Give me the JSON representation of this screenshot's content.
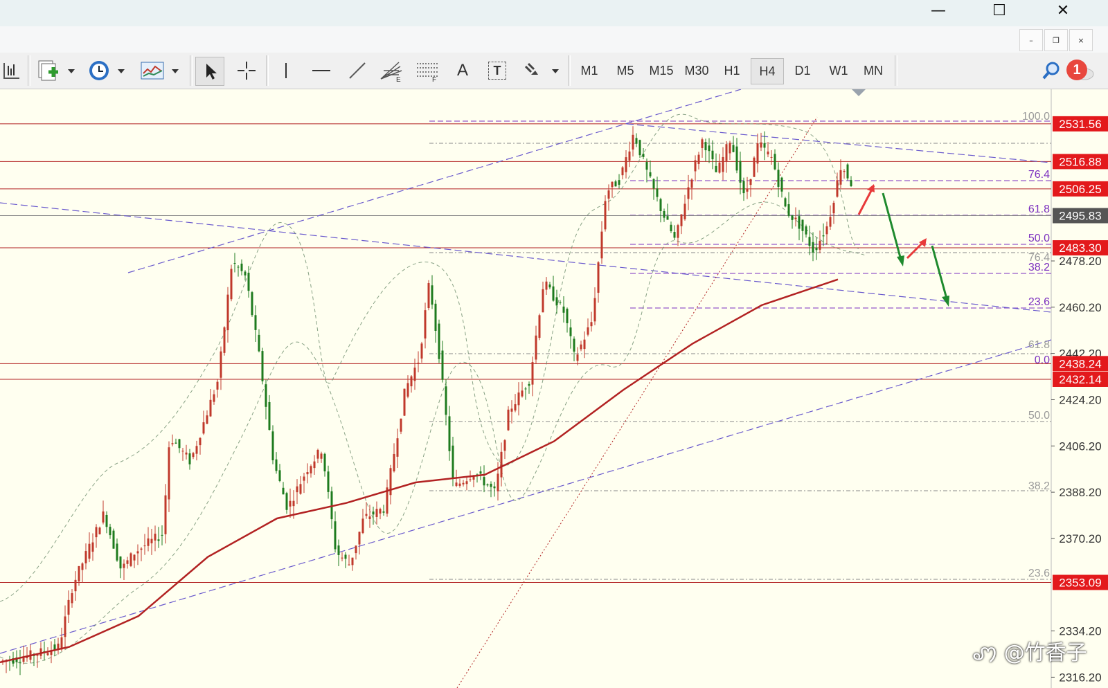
{
  "window": {
    "controls": {
      "minimize": "—",
      "maximize": "☐",
      "close": "✕"
    },
    "mdi_controls": {
      "minimize": "–",
      "restore": "❐",
      "close": "×"
    }
  },
  "toolbar": {
    "tools": [
      {
        "name": "crosshair-bars-icon"
      },
      {
        "name": "new-chart-icon"
      },
      {
        "name": "history-clock-icon"
      },
      {
        "name": "indicators-icon"
      },
      {
        "name": "cursor-icon"
      },
      {
        "name": "crosshair-icon"
      },
      {
        "name": "vertical-line-icon"
      },
      {
        "name": "horizontal-line-icon"
      },
      {
        "name": "trend-line-icon"
      },
      {
        "name": "fibonacci-fan-icon"
      },
      {
        "name": "fibonacci-retracement-icon"
      }
    ],
    "text_tool": "A",
    "text_label_tool": "T",
    "timeframes": [
      "M1",
      "M5",
      "M15",
      "M30",
      "H1",
      "H4",
      "D1",
      "W1",
      "MN"
    ],
    "active_timeframe": "H4",
    "notification_count": "1"
  },
  "chart_data": {
    "type": "line",
    "chart_kind": "candlestick",
    "timeframe": "H4",
    "price_axis": {
      "labels": [
        "2531.56",
        "2516.88",
        "2506.25",
        "2495.83",
        "2483.30",
        "2478.20",
        "2460.20",
        "2442.20",
        "2438.24",
        "2432.14",
        "2424.20",
        "2406.20",
        "2388.20",
        "2370.20",
        "2353.09",
        "2334.20",
        "2316.20"
      ],
      "ylim": [
        2312,
        2545
      ]
    },
    "horizontal_levels": [
      {
        "price": "2531.56",
        "highlight": true
      },
      {
        "price": "2516.88",
        "highlight": true
      },
      {
        "price": "2506.25",
        "highlight": true
      },
      {
        "price": "2495.83",
        "highlight": false
      },
      {
        "price": "2483.30",
        "highlight": true
      },
      {
        "price": "2438.24",
        "highlight": true
      },
      {
        "price": "2432.14",
        "highlight": true
      },
      {
        "price": "2353.09",
        "highlight": true
      }
    ],
    "fibo_upper": [
      "100.0",
      "76.4",
      "61.8",
      "50.0",
      "38.2",
      "23.6",
      "0.0"
    ],
    "fibo_lower": [
      "76.4",
      "61.8",
      "50.0",
      "38.2",
      "23.6"
    ],
    "moving_average": {
      "x": [
        0,
        100,
        200,
        300,
        400,
        500,
        600,
        700,
        800,
        900,
        1000,
        1100,
        1210
      ],
      "y": [
        2322,
        2328,
        2340,
        2363,
        2378,
        2384,
        2392,
        2395,
        2408,
        2428,
        2446,
        2461,
        2471
      ]
    },
    "colors": {
      "background": "#fffff0",
      "up_candle": "#c0392b",
      "down_candle": "#1e7b1e",
      "level_line": "#b22222",
      "price_tag": "#e3191c",
      "current_tag": "#555555",
      "fibo": "#7b2fbf",
      "channel": "#6a5acd",
      "ma": "#b22222",
      "arrow_up": "#e83a3a",
      "arrow_down": "#1f8a2e"
    }
  },
  "watermark": "ꩇ @竹香子"
}
